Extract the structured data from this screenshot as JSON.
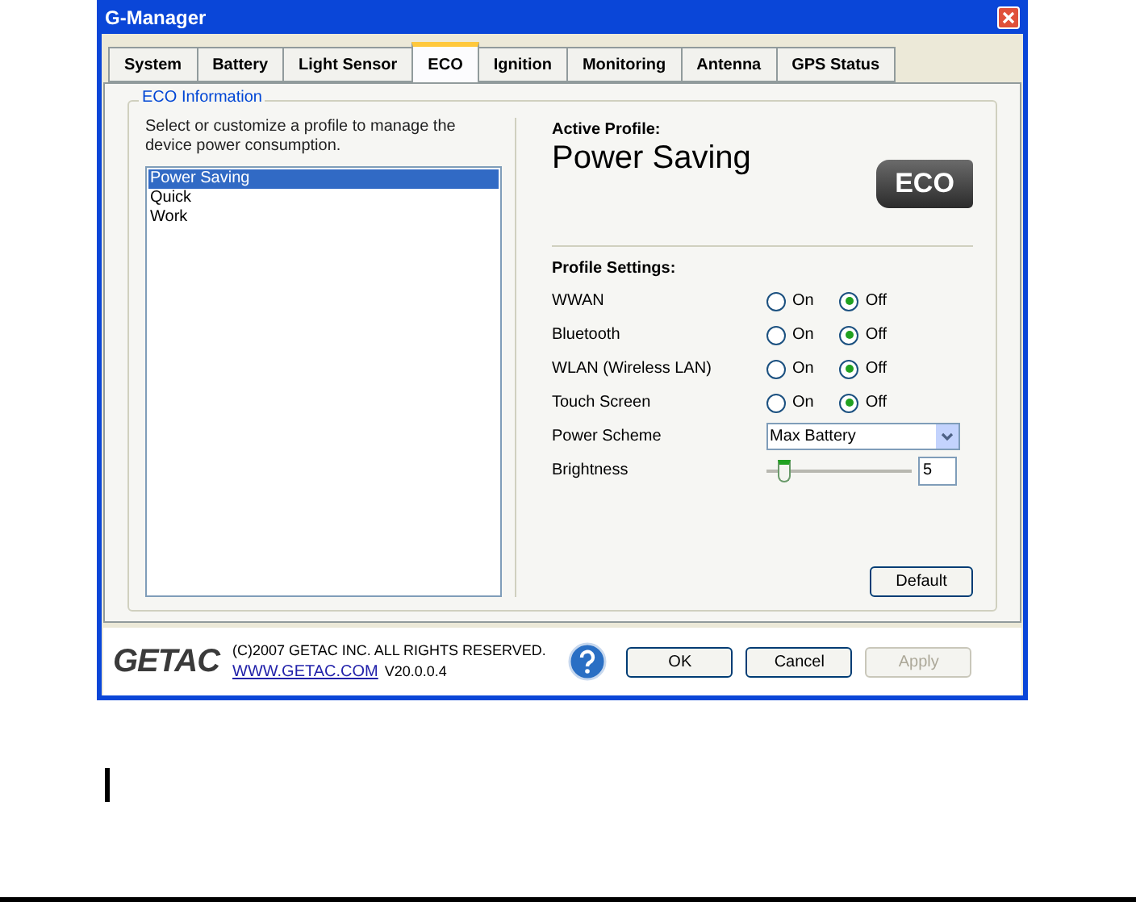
{
  "window": {
    "title": "G-Manager"
  },
  "tabs": [
    {
      "label": "System",
      "selected": false
    },
    {
      "label": "Battery",
      "selected": false
    },
    {
      "label": "Light Sensor",
      "selected": false
    },
    {
      "label": "ECO",
      "selected": true
    },
    {
      "label": "Ignition",
      "selected": false
    },
    {
      "label": "Monitoring",
      "selected": false
    },
    {
      "label": "Antenna",
      "selected": false
    },
    {
      "label": "GPS Status",
      "selected": false
    }
  ],
  "group": {
    "title": "ECO Information",
    "description": "Select or customize a profile to manage the device power consumption."
  },
  "profiles": [
    {
      "label": "Power Saving",
      "selected": true
    },
    {
      "label": "Quick",
      "selected": false
    },
    {
      "label": "Work",
      "selected": false
    }
  ],
  "active_profile": {
    "label": "Active Profile:",
    "name": "Power Saving",
    "logo": "ECO"
  },
  "settings": {
    "title": "Profile Settings:",
    "rows": [
      {
        "kind": "radio",
        "label": "WWAN",
        "options": [
          {
            "label": "On",
            "selected": false
          },
          {
            "label": "Off",
            "selected": true
          }
        ]
      },
      {
        "kind": "radio",
        "label": "Bluetooth",
        "options": [
          {
            "label": "On",
            "selected": false
          },
          {
            "label": "Off",
            "selected": true
          }
        ]
      },
      {
        "kind": "radio",
        "label": "WLAN (Wireless LAN)",
        "options": [
          {
            "label": "On",
            "selected": false
          },
          {
            "label": "Off",
            "selected": true
          }
        ]
      },
      {
        "kind": "radio",
        "label": "Touch Screen",
        "options": [
          {
            "label": "On",
            "selected": false
          },
          {
            "label": "Off",
            "selected": true
          }
        ]
      },
      {
        "kind": "dropdown",
        "label": "Power Scheme",
        "value": "Max Battery"
      },
      {
        "kind": "slider",
        "label": "Brightness",
        "level": 0.08,
        "value": "5"
      }
    ]
  },
  "default_button": "Default",
  "footer": {
    "brand": "GETAC",
    "copyright": "(C)2007 GETAC INC. ALL RIGHTS RESERVED.",
    "link": "WWW.GETAC.COM",
    "version": "V20.0.0.4",
    "buttons": [
      {
        "label": "OK",
        "disabled": false
      },
      {
        "label": "Cancel",
        "disabled": false
      },
      {
        "label": "Apply",
        "disabled": true
      }
    ]
  }
}
